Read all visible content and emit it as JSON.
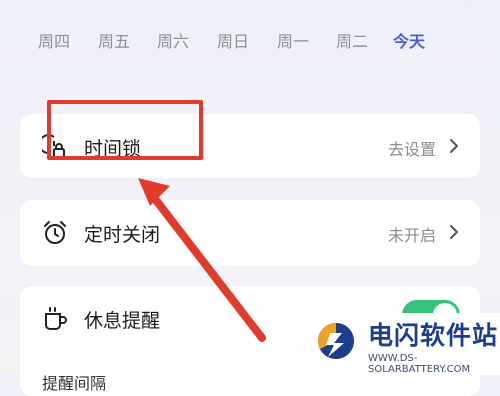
{
  "week": {
    "days": [
      "周四",
      "周五",
      "周六",
      "周日",
      "周一",
      "周二"
    ],
    "today": "今天"
  },
  "settings": {
    "time_lock": {
      "label": "时间锁",
      "value": "去设置"
    },
    "timer_off": {
      "label": "定时关闭",
      "value": "未开启"
    },
    "rest_reminder": {
      "label": "休息提醒",
      "enabled": true,
      "sub_label": "提醒间隔"
    }
  },
  "annotation": {
    "color": "#e23b2c"
  },
  "watermark": {
    "title": "电闪软件站",
    "url": "WWW.DS-SOLARBATTERY.COM"
  },
  "colors": {
    "accent": "#4a5fd0",
    "toggle_on": "#35c37a"
  }
}
